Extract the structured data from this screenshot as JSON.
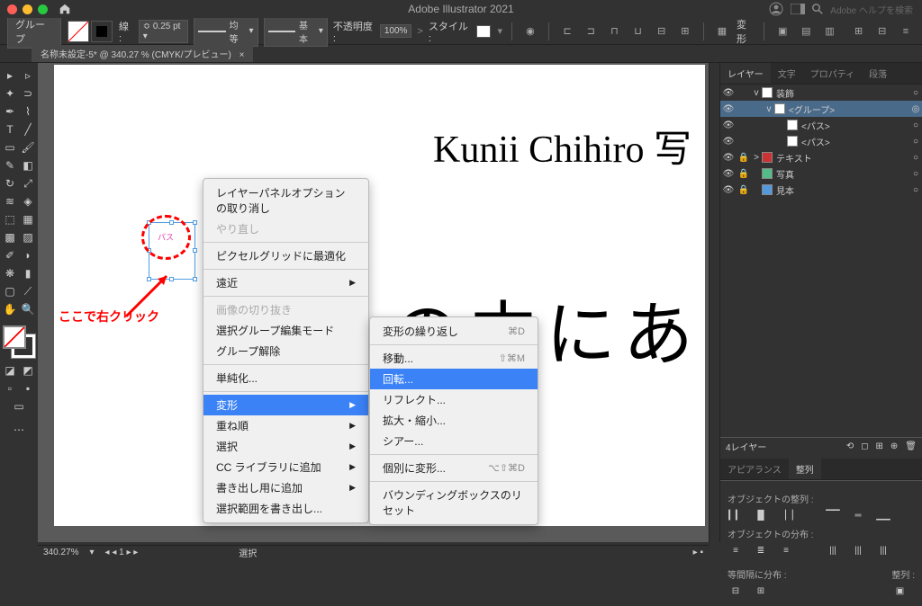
{
  "titlebar": {
    "app_name": "Adobe Illustrator 2021",
    "search_placeholder": "Adobe ヘルプを検索"
  },
  "controlbar": {
    "object_label": "グループ",
    "stroke_label": "線 :",
    "stroke_width": "0.25 pt",
    "uniform_label": "均等",
    "basic_label": "基本",
    "opacity_label": "不透明度 :",
    "opacity_value": "100%",
    "style_label": "スタイル :",
    "transform_label": "変形"
  },
  "doctab": {
    "label": "名称未設定-5* @ 340.27 % (CMYK/プレビュー)",
    "close": "×"
  },
  "canvas": {
    "text1": "Kunii Chihiro 写",
    "text2": "の中にあ",
    "selection_label": "パス",
    "annotation_text": "ここで右クリック"
  },
  "context_menu_1": [
    {
      "type": "item",
      "label": "レイヤーパネルオプションの取り消し"
    },
    {
      "type": "item",
      "label": "やり直し",
      "disabled": true
    },
    {
      "type": "sep"
    },
    {
      "type": "item",
      "label": "ピクセルグリッドに最適化"
    },
    {
      "type": "sep"
    },
    {
      "type": "item",
      "label": "遠近",
      "submenu": true
    },
    {
      "type": "sep"
    },
    {
      "type": "item",
      "label": "画像の切り抜き",
      "disabled": true
    },
    {
      "type": "item",
      "label": "選択グループ編集モード"
    },
    {
      "type": "item",
      "label": "グループ解除"
    },
    {
      "type": "sep"
    },
    {
      "type": "item",
      "label": "単純化..."
    },
    {
      "type": "sep"
    },
    {
      "type": "item",
      "label": "変形",
      "submenu": true,
      "highlighted": true
    },
    {
      "type": "item",
      "label": "重ね順",
      "submenu": true
    },
    {
      "type": "item",
      "label": "選択",
      "submenu": true
    },
    {
      "type": "item",
      "label": "CC ライブラリに追加",
      "submenu": true
    },
    {
      "type": "item",
      "label": "書き出し用に追加",
      "submenu": true
    },
    {
      "type": "item",
      "label": "選択範囲を書き出し..."
    }
  ],
  "context_menu_2": [
    {
      "label": "変形の繰り返し",
      "shortcut": "⌘D"
    },
    {
      "type": "sep"
    },
    {
      "label": "移動...",
      "shortcut": "⇧⌘M"
    },
    {
      "label": "回転...",
      "highlighted": true
    },
    {
      "label": "リフレクト..."
    },
    {
      "label": "拡大・縮小..."
    },
    {
      "label": "シアー..."
    },
    {
      "type": "sep"
    },
    {
      "label": "個別に変形...",
      "shortcut": "⌥⇧⌘D"
    },
    {
      "type": "sep"
    },
    {
      "label": "バウンディングボックスのリセット"
    }
  ],
  "panels": {
    "tabs": [
      "レイヤー",
      "文字",
      "プロパティ",
      "段落"
    ],
    "active_tab": 0,
    "layers": [
      {
        "vis": true,
        "name": "装飾",
        "indent": 0,
        "twisty": "v",
        "color": "#fff",
        "target": "○"
      },
      {
        "vis": true,
        "name": "<グループ>",
        "indent": 1,
        "twisty": "v",
        "color": "#fff",
        "selected": true,
        "target": "◎"
      },
      {
        "vis": true,
        "name": "<パス>",
        "indent": 2,
        "color": "#fff",
        "target": "○"
      },
      {
        "vis": true,
        "name": "<パス>",
        "indent": 2,
        "color": "#fff",
        "target": "○"
      },
      {
        "vis": true,
        "lock": true,
        "name": "テキスト",
        "indent": 0,
        "twisty": ">",
        "color": "#c33",
        "target": "○"
      },
      {
        "vis": true,
        "lock": true,
        "name": "写真",
        "indent": 0,
        "color": "#5b8",
        "target": "○"
      },
      {
        "vis": true,
        "lock": true,
        "name": "見本",
        "indent": 0,
        "color": "#59d",
        "target": "○"
      }
    ],
    "layer_count": "4レイヤー",
    "align": {
      "tabs": [
        "アピアランス",
        "整列"
      ],
      "section1": "オブジェクトの整列 :",
      "section2": "オブジェクトの分布 :",
      "section3": "等間隔に分布 :",
      "section4": "整列 :"
    }
  },
  "status": {
    "zoom": "340.27%",
    "page": "1",
    "mode": "選択"
  }
}
